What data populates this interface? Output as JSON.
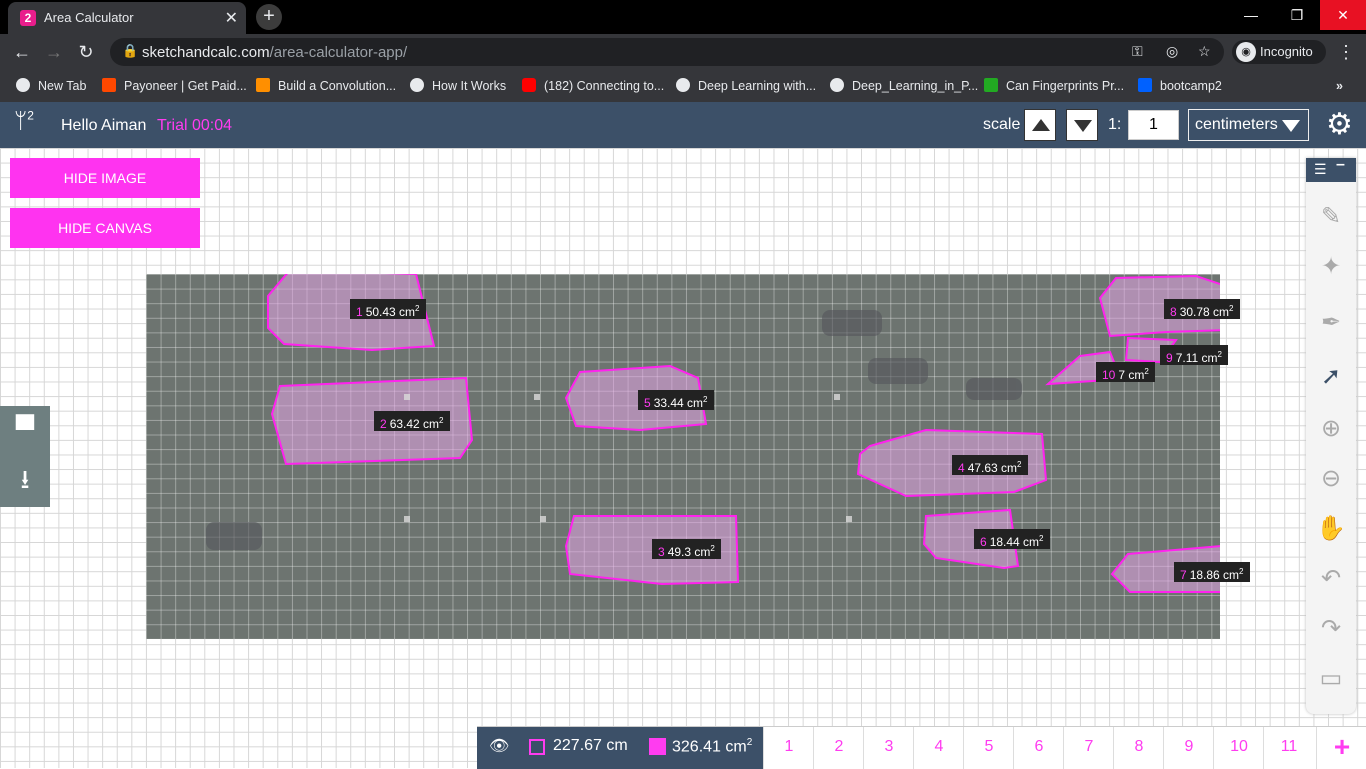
{
  "browser": {
    "tab_title": "Area Calculator",
    "tab_badge": "2",
    "url_host": "sketchandcalc.com",
    "url_path": "/area-calculator-app/",
    "incognito_label": "Incognito",
    "bookmarks": [
      {
        "label": "New Tab",
        "color": "#e8eaed"
      },
      {
        "label": "Payoneer | Get Paid...",
        "color": "#ff4800"
      },
      {
        "label": "Build a Convolution...",
        "color": "#ff8f00"
      },
      {
        "label": "How It Works",
        "color": "#e8eaed"
      },
      {
        "label": "(182) Connecting to...",
        "color": "#ff0000"
      },
      {
        "label": "Deep Learning with...",
        "color": "#e8eaed"
      },
      {
        "label": "Deep_Learning_in_P...",
        "color": "#e8eaed"
      },
      {
        "label": "Can Fingerprints Pr...",
        "color": "#2a2"
      },
      {
        "label": "bootcamp2",
        "color": "#0061ff"
      }
    ]
  },
  "app": {
    "greeting": "Hello Aiman",
    "trial": "Trial 00:04",
    "scale_label": "scale",
    "ratio_label": "1:",
    "scale_value": "1",
    "unit": "centimeters",
    "hide_image": "HIDE IMAGE",
    "hide_canvas": "HIDE CANVAS",
    "accent_color": "#ff33f0",
    "header_color": "#3c5068"
  },
  "shapes": [
    {
      "num": "1",
      "value": "50.43 cm",
      "unit_sup": "2"
    },
    {
      "num": "2",
      "value": "63.42 cm",
      "unit_sup": "2"
    },
    {
      "num": "3",
      "value": "49.3 cm",
      "unit_sup": "2"
    },
    {
      "num": "4",
      "value": "47.63 cm",
      "unit_sup": "2"
    },
    {
      "num": "5",
      "value": "33.44 cm",
      "unit_sup": "2"
    },
    {
      "num": "6",
      "value": "18.44 cm",
      "unit_sup": "2"
    },
    {
      "num": "7",
      "value": "18.86 cm",
      "unit_sup": "2"
    },
    {
      "num": "8",
      "value": "30.78 cm",
      "unit_sup": "2"
    },
    {
      "num": "9",
      "value": "7.11 cm",
      "unit_sup": "2"
    },
    {
      "num": "10",
      "value": "7 cm",
      "unit_sup": "2"
    }
  ],
  "totals": {
    "perimeter": "227.67 cm",
    "area": "326.41 cm",
    "area_sup": "2"
  },
  "pages": [
    "1",
    "2",
    "3",
    "4",
    "5",
    "6",
    "7",
    "8",
    "9",
    "10",
    "11"
  ],
  "add_page": "+",
  "tools": [
    "ruler-icon",
    "magic-wand-icon",
    "pen-icon",
    "pointer-icon",
    "zoom-in-icon",
    "zoom-out-icon",
    "hand-icon",
    "undo-icon",
    "redo-icon",
    "comment-icon"
  ]
}
